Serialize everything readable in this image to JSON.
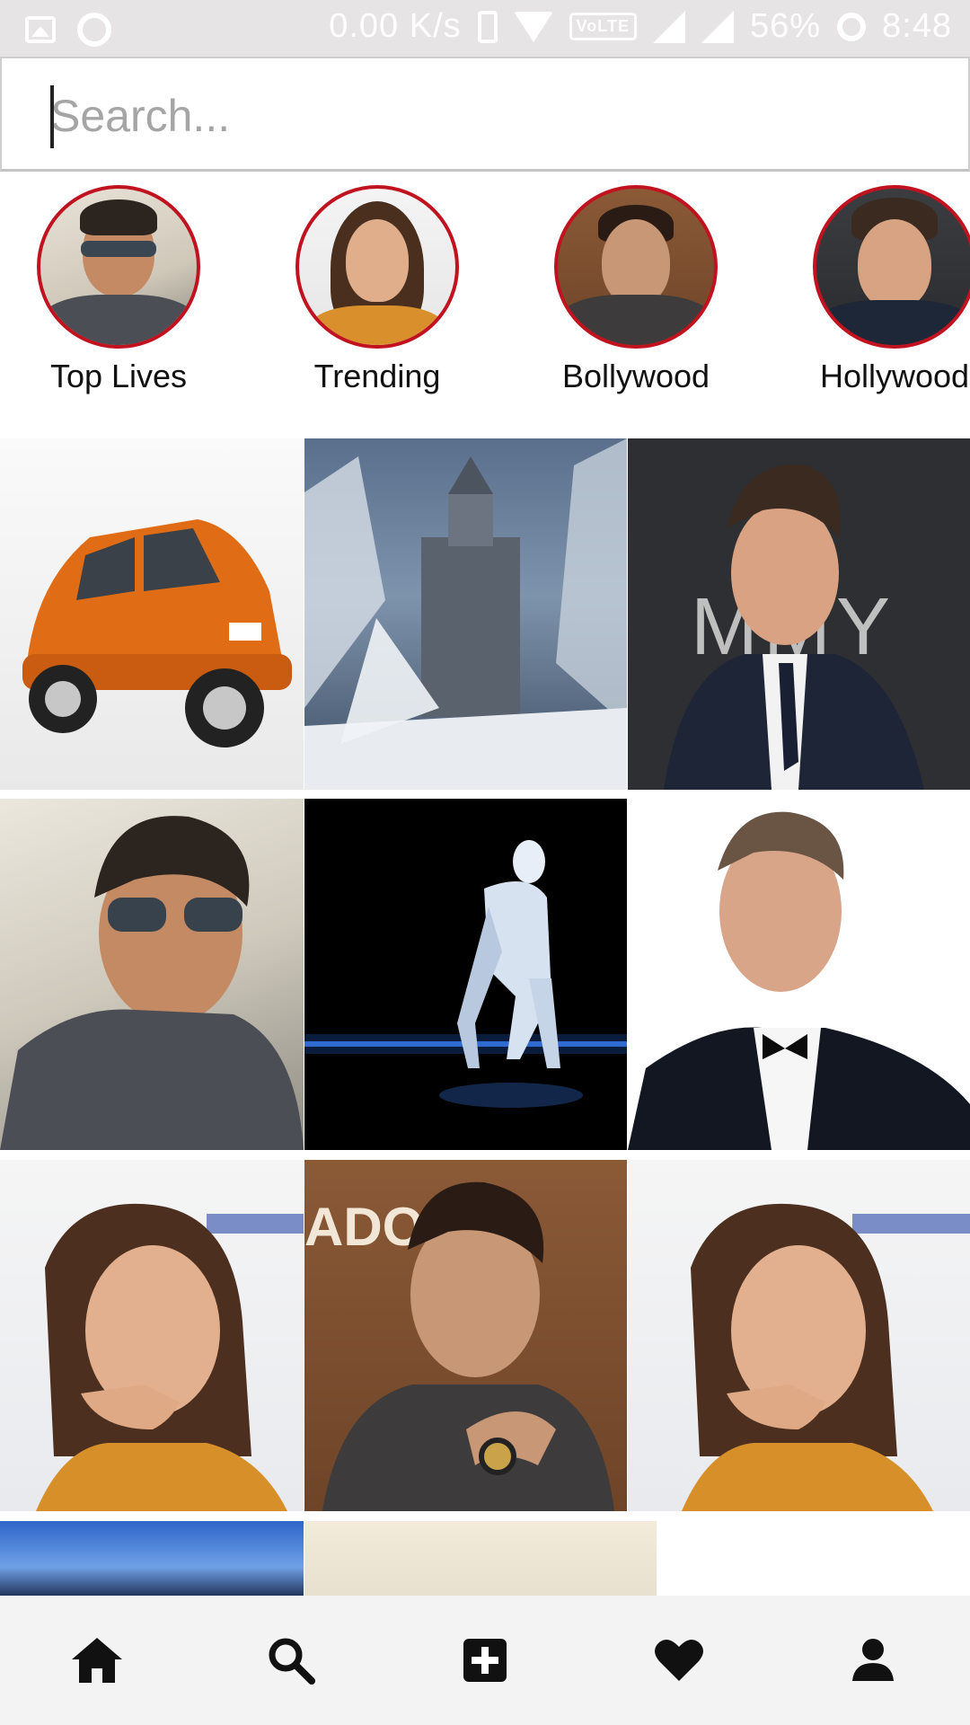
{
  "status_bar": {
    "speed": "0.00 K/s",
    "network": "VoLTE",
    "battery": "56%",
    "time": "8:48"
  },
  "search": {
    "placeholder": "Search...",
    "value": ""
  },
  "stories": [
    {
      "label": "Top Lives"
    },
    {
      "label": "Trending"
    },
    {
      "label": "Bollywood"
    },
    {
      "label": "Hollywood"
    }
  ],
  "grid": {
    "tiles": [
      {
        "name": "orange-car-photo",
        "alt": "Orange hatchback car"
      },
      {
        "name": "icy-fortress-photo",
        "alt": "Icy mountain fortress"
      },
      {
        "name": "man-in-suit-premiere-photo",
        "alt": "Man in suit at premiere"
      },
      {
        "name": "man-with-sunglasses-photo",
        "alt": "Man wearing sunglasses"
      },
      {
        "name": "robot-runner-photo",
        "alt": "Robot in starting position"
      },
      {
        "name": "man-in-tuxedo-photo",
        "alt": "Man in tuxedo"
      },
      {
        "name": "woman-chin-on-hand-photo",
        "alt": "Woman resting chin on hand"
      },
      {
        "name": "man-with-watch-photo",
        "alt": "Man showing wristwatch"
      },
      {
        "name": "woman-chin-on-hand-photo-2",
        "alt": "Woman resting chin on hand"
      },
      {
        "name": "sky-landscape-photo",
        "alt": "Sky landscape"
      },
      {
        "name": "room-interior-photo",
        "alt": "Room interior"
      }
    ]
  },
  "bottom_nav": [
    {
      "name": "home-icon"
    },
    {
      "name": "search-icon"
    },
    {
      "name": "add-post-icon"
    },
    {
      "name": "heart-icon"
    },
    {
      "name": "profile-icon"
    }
  ],
  "colors": {
    "story_ring": "#c1121f",
    "status_bar_bg": "#e6e4e4",
    "nav_bg": "#f3f3f3"
  }
}
